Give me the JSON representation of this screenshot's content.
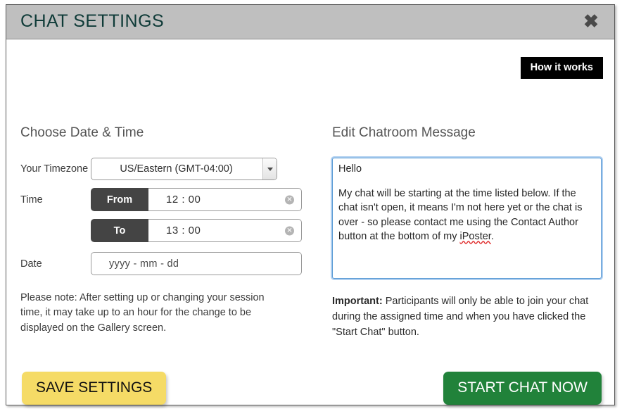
{
  "dialog": {
    "title": "CHAT SETTINGS",
    "close_icon": "close-icon",
    "how_it_works_label": "How it works"
  },
  "left_column": {
    "heading": "Choose Date & Time",
    "timezone": {
      "label": "Your Timezone",
      "value": "US/Eastern (GMT-04:00)",
      "arrow_icon": "chevron-down-icon"
    },
    "time": {
      "label": "Time",
      "from_label": "From",
      "from_value": "12 : 00",
      "to_label": "To",
      "to_value": "13 : 00",
      "clear_icon": "circle-x-icon"
    },
    "date": {
      "label": "Date",
      "placeholder": "yyyy - mm - dd",
      "value": ""
    },
    "note": "Please note: After setting up or changing your session time, it may take up to an hour for the change to be displayed on the Gallery screen."
  },
  "right_column": {
    "heading": "Edit Chatroom Message",
    "message": {
      "line1": "Hello",
      "body_before_spell": "My chat will be starting at the time listed below. If the chat isn't open, it means I'm not here yet or the chat is over - so please contact me using the Contact Author button at the bottom of my ",
      "spell_word": "iPoster",
      "body_after_spell": "."
    },
    "important": {
      "prefix": "Important:",
      "text": " Participants will only be able to join your chat during the assigned time and when you have clicked the \"Start Chat\" button."
    }
  },
  "actions": {
    "save_label": "SAVE SETTINGS",
    "start_label": "START CHAT NOW"
  },
  "colors": {
    "header_bg": "#bfbfbf",
    "title": "#0f3b38",
    "save_bg": "#f5db66",
    "start_bg": "#21823a",
    "focus_border": "#5b9bd5",
    "prefix_bg": "#444444",
    "how_it_works_bg": "#000000"
  }
}
